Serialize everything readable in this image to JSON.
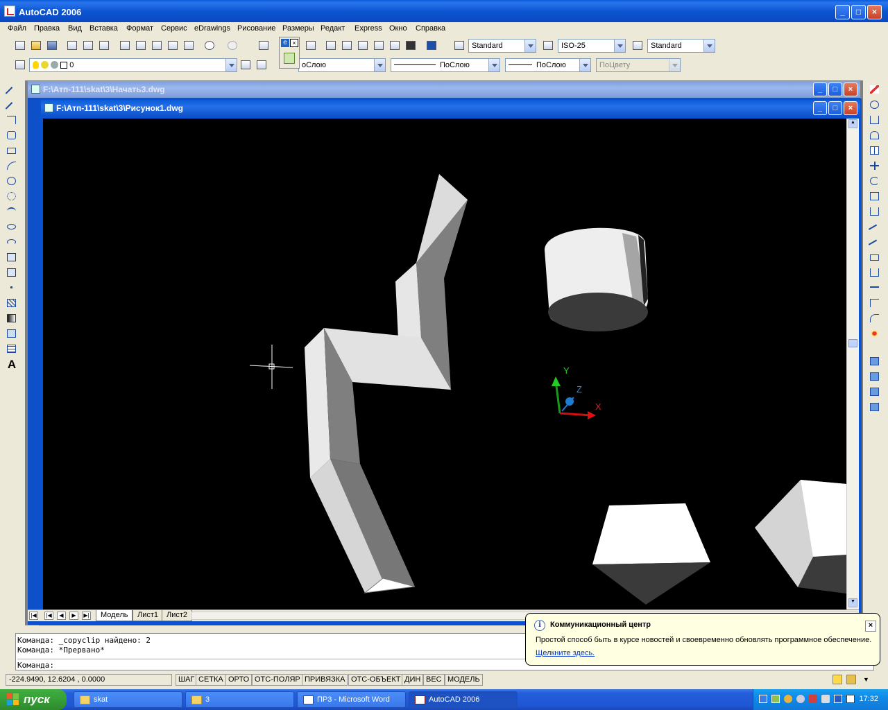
{
  "app": {
    "title": "AutoCAD 2006"
  },
  "menu": [
    "Файл",
    "Правка",
    "Вид",
    "Вставка",
    "Формат",
    "Сервис",
    "eDrawings",
    "Рисование",
    "Размеры",
    "Редакт",
    "Express",
    "Окно",
    "Справка"
  ],
  "toolbar": {
    "text_style": "Standard",
    "dim_style": "ISO-25",
    "table_style": "Standard",
    "layer": "0",
    "color": "оСлою",
    "linetype": "ПоСлою",
    "lineweight": "ПоСлою",
    "plot_style": "ПоЦвету"
  },
  "windows": {
    "back_doc": {
      "title": "F:\\Атп-111\\skat\\3\\Начать3.dwg"
    },
    "front_doc": {
      "title": "F:\\Атп-111\\skat\\3\\Рисунок1.dwg"
    }
  },
  "ucs": {
    "x": "X",
    "y": "Y",
    "z": "Z"
  },
  "layout_tabs": [
    "Модель",
    "Лист1",
    "Лист2"
  ],
  "command": {
    "line1": "Команда: _copyclip найдено: 2",
    "line2": "Команда: *Прервано*",
    "prompt": "Команда:"
  },
  "status": {
    "coords": "-224.9490, 12.6204 , 0.0000",
    "buttons": [
      "ШАГ",
      "СЕТКА",
      "ОРТО",
      "ОТС-ПОЛЯР",
      "ПРИВЯЗКА",
      "ОТС-ОБЪЕКТ",
      "ДИН",
      "ВЕС",
      "МОДЕЛЬ"
    ]
  },
  "balloon": {
    "title": "Коммуникационный центр",
    "text": "Простой способ быть в курсе новостей и своевременно обновлять программное обеспечение.",
    "link": "Щелкните здесь."
  },
  "taskbar": {
    "start": "пуск",
    "tasks": [
      "skat",
      "3",
      "ПР3 - Microsoft Word",
      "AutoCAD 2006"
    ],
    "clock": "17:32"
  }
}
